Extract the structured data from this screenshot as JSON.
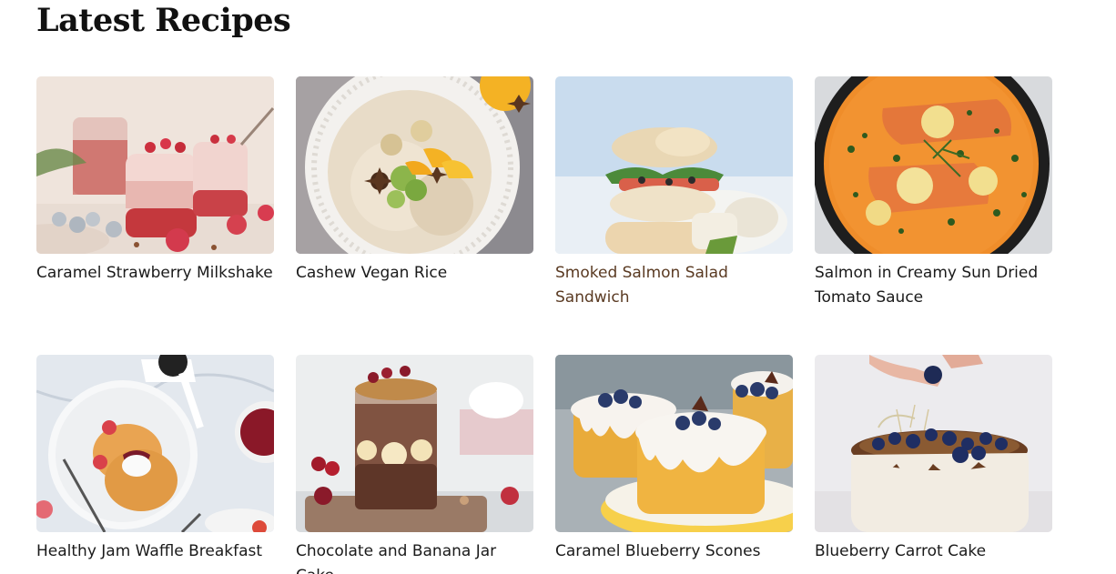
{
  "section": {
    "title": "Latest Recipes"
  },
  "recipes": [
    {
      "title": "Caramel Strawberry Milkshake",
      "image": "strawberry-milkshake-photo"
    },
    {
      "title": "Cashew Vegan Rice",
      "image": "cashew-rice-bowl-photo"
    },
    {
      "title": "Smoked Salmon Salad Sandwich",
      "image": "salmon-sandwich-photo",
      "hovered": true
    },
    {
      "title": "Salmon in Creamy Sun Dried Tomato Sauce",
      "image": "salmon-pan-photo"
    },
    {
      "title": "Healthy Jam Waffle Breakfast",
      "image": "jam-waffle-photo"
    },
    {
      "title": "Chocolate and Banana Jar Cake",
      "image": "banana-jar-cake-photo"
    },
    {
      "title": "Caramel Blueberry Scones",
      "image": "blueberry-scones-photo"
    },
    {
      "title": "Blueberry Carrot Cake",
      "image": "carrot-cake-photo"
    }
  ],
  "colors": {
    "title_text": "#111111",
    "card_text": "#1a1a1a",
    "hovered_text": "#5a3a22"
  }
}
